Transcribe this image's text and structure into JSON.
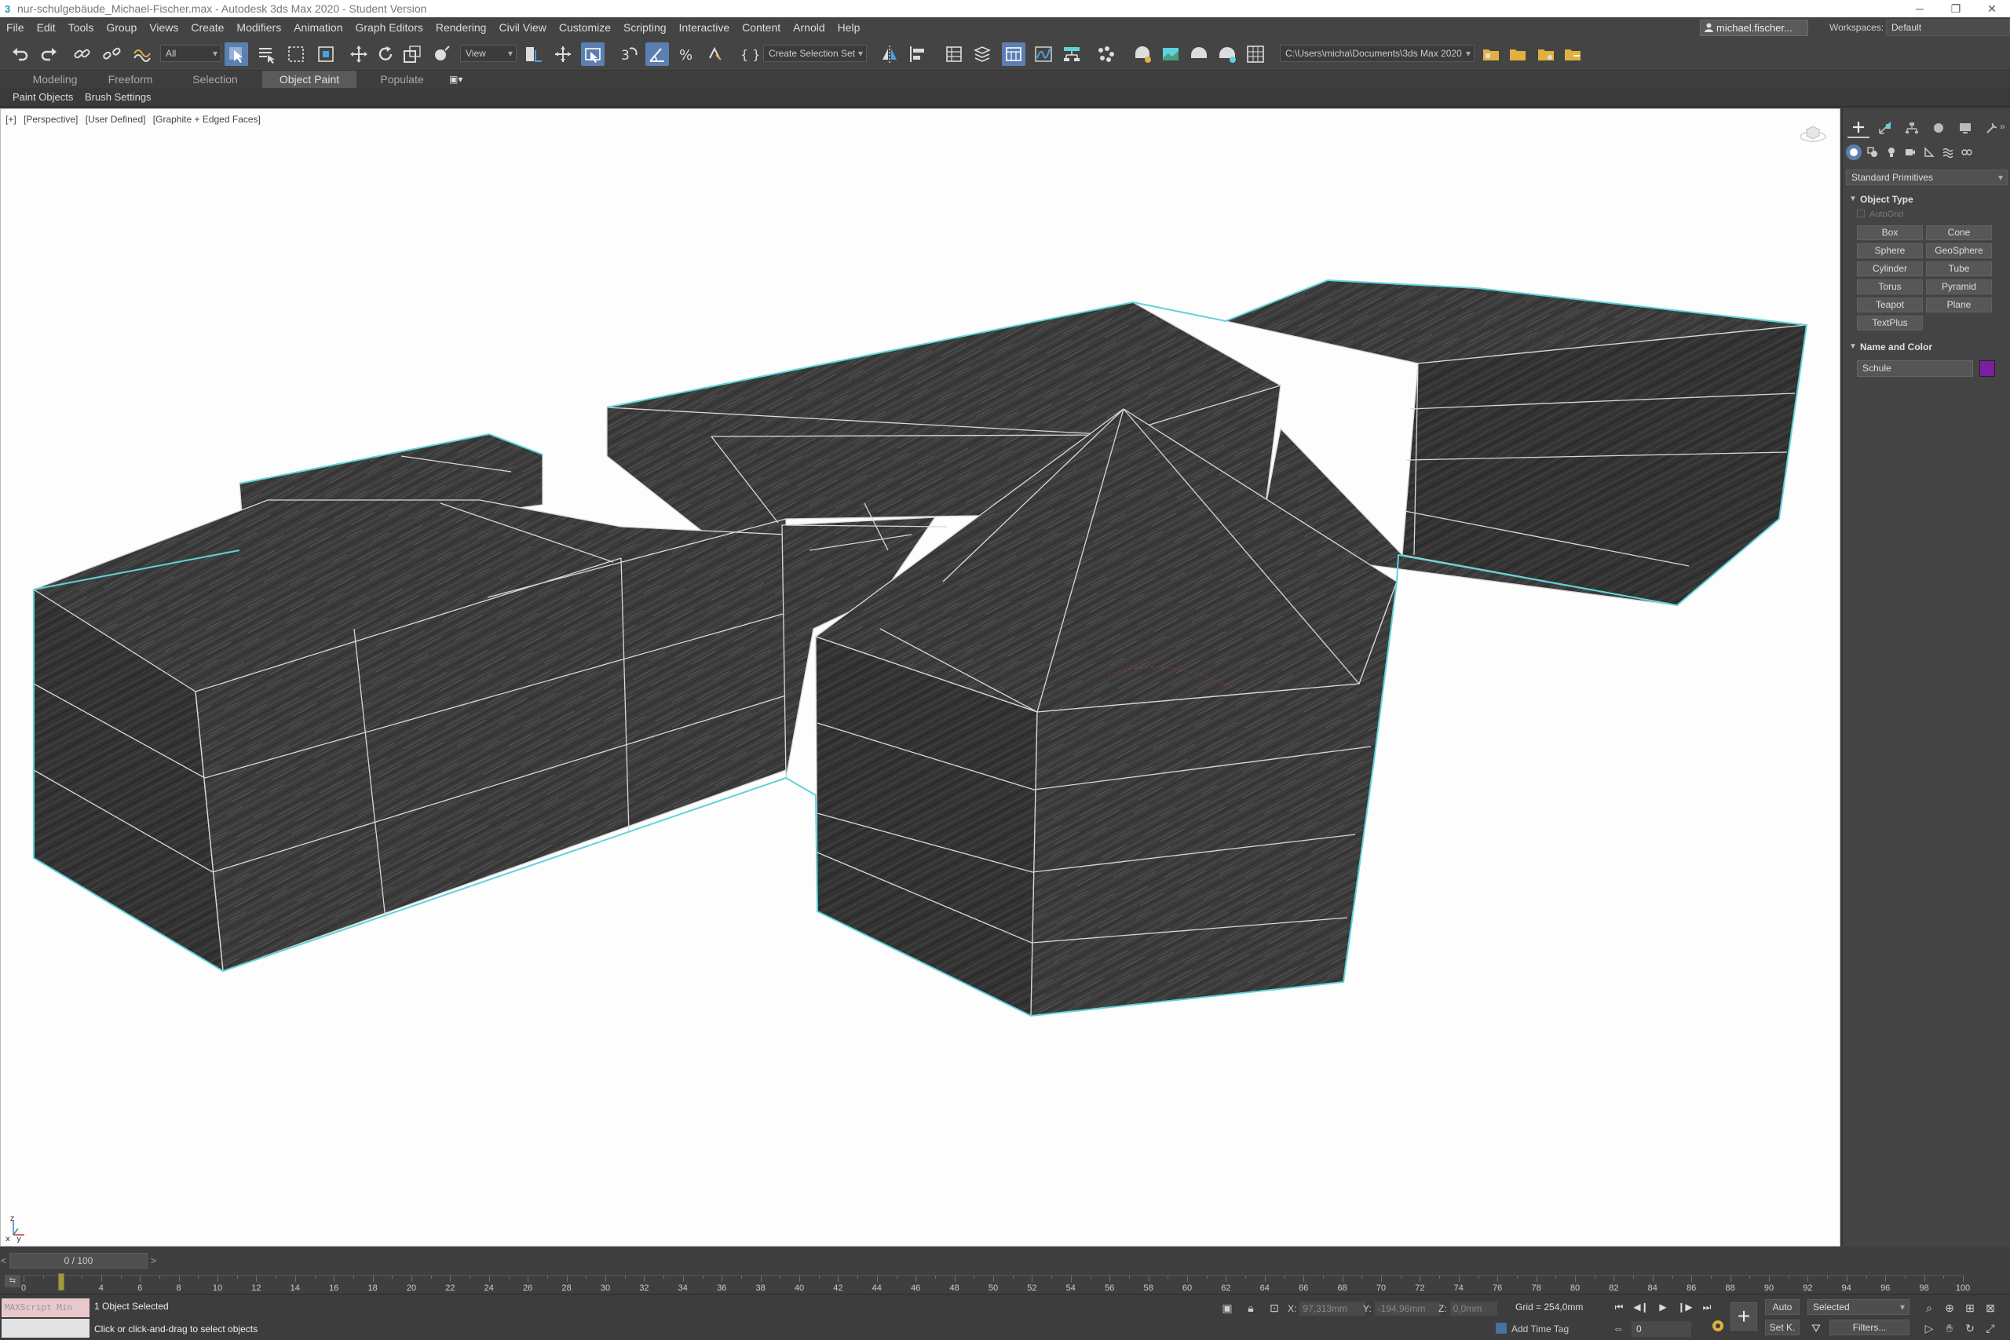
{
  "window": {
    "title": "nur-schulgebäude_Michael-Fischer.max - Autodesk 3ds Max 2020 - Student Version",
    "controls": [
      "─",
      "❐",
      "✕"
    ]
  },
  "menu": [
    "File",
    "Edit",
    "Tools",
    "Group",
    "Views",
    "Create",
    "Modifiers",
    "Animation",
    "Graph Editors",
    "Rendering",
    "Civil View",
    "Customize",
    "Scripting",
    "Interactive",
    "Content",
    "Arnold",
    "Help"
  ],
  "account": {
    "user": "michael.fischer..."
  },
  "workspace": {
    "label": "Workspaces:",
    "value": "Default"
  },
  "toolbar": {
    "filter": "All",
    "ref_coord": "View",
    "selection_set": "Create Selection Set",
    "project_path": "C:\\Users\\micha\\Documents\\3ds Max 2020"
  },
  "ribbon": {
    "tabs": [
      "Modeling",
      "Freeform",
      "Selection",
      "Object Paint",
      "Populate"
    ],
    "active_tab": "Object Paint",
    "sub_items": [
      "Paint Objects",
      "Brush Settings"
    ]
  },
  "viewport": {
    "labels": [
      "[+]",
      "[Perspective]",
      "[User Defined]",
      "[Graphite + Edged Faces]"
    ],
    "axis_x": "x",
    "axis_y": "y",
    "axis_z": "z",
    "colors": {
      "face": "#3a3a3a",
      "edge": "#d8d8d8",
      "outline": "#5fd3dc",
      "background": "#fdfdfd"
    }
  },
  "command_panel": {
    "category": "Standard Primitives",
    "object_type": {
      "title": "Object Type",
      "autogrid": "AutoGrid",
      "buttons": [
        "Box",
        "Cone",
        "Sphere",
        "GeoSphere",
        "Cylinder",
        "Tube",
        "Torus",
        "Pyramid",
        "Teapot",
        "Plane",
        "TextPlus"
      ]
    },
    "name_color": {
      "title": "Name and Color",
      "name": "Schule",
      "color": "#7a1fa0"
    }
  },
  "timeline": {
    "slider": "0 / 100",
    "start": 0,
    "end": 100,
    "current": 0,
    "labels": [
      "0",
      "2",
      "4",
      "6",
      "8",
      "10",
      "12",
      "14",
      "16",
      "18",
      "20",
      "22",
      "24",
      "26",
      "28",
      "30",
      "32",
      "34",
      "36",
      "38",
      "40",
      "42",
      "44",
      "46",
      "48",
      "50",
      "52",
      "54",
      "56",
      "58",
      "60",
      "62",
      "64",
      "66",
      "68",
      "70",
      "72",
      "74",
      "76",
      "78",
      "80",
      "82",
      "84",
      "86",
      "88",
      "90",
      "92",
      "94",
      "96",
      "98",
      "100"
    ]
  },
  "status": {
    "maxscript": "MAXScript Min",
    "selection": "1 Object Selected",
    "prompt": "Click or click-and-drag to select objects",
    "x_label": "X:",
    "x": "97,313mm",
    "y_label": "Y:",
    "y": "-194,96mm",
    "z_label": "Z:",
    "z": "0,0mm",
    "grid": "Grid = 254,0mm",
    "add_time_tag": "Add Time Tag",
    "frame": "0",
    "auto": "Auto",
    "set_k": "Set K.",
    "key_filter": "Selected",
    "filters": "Filters..."
  }
}
